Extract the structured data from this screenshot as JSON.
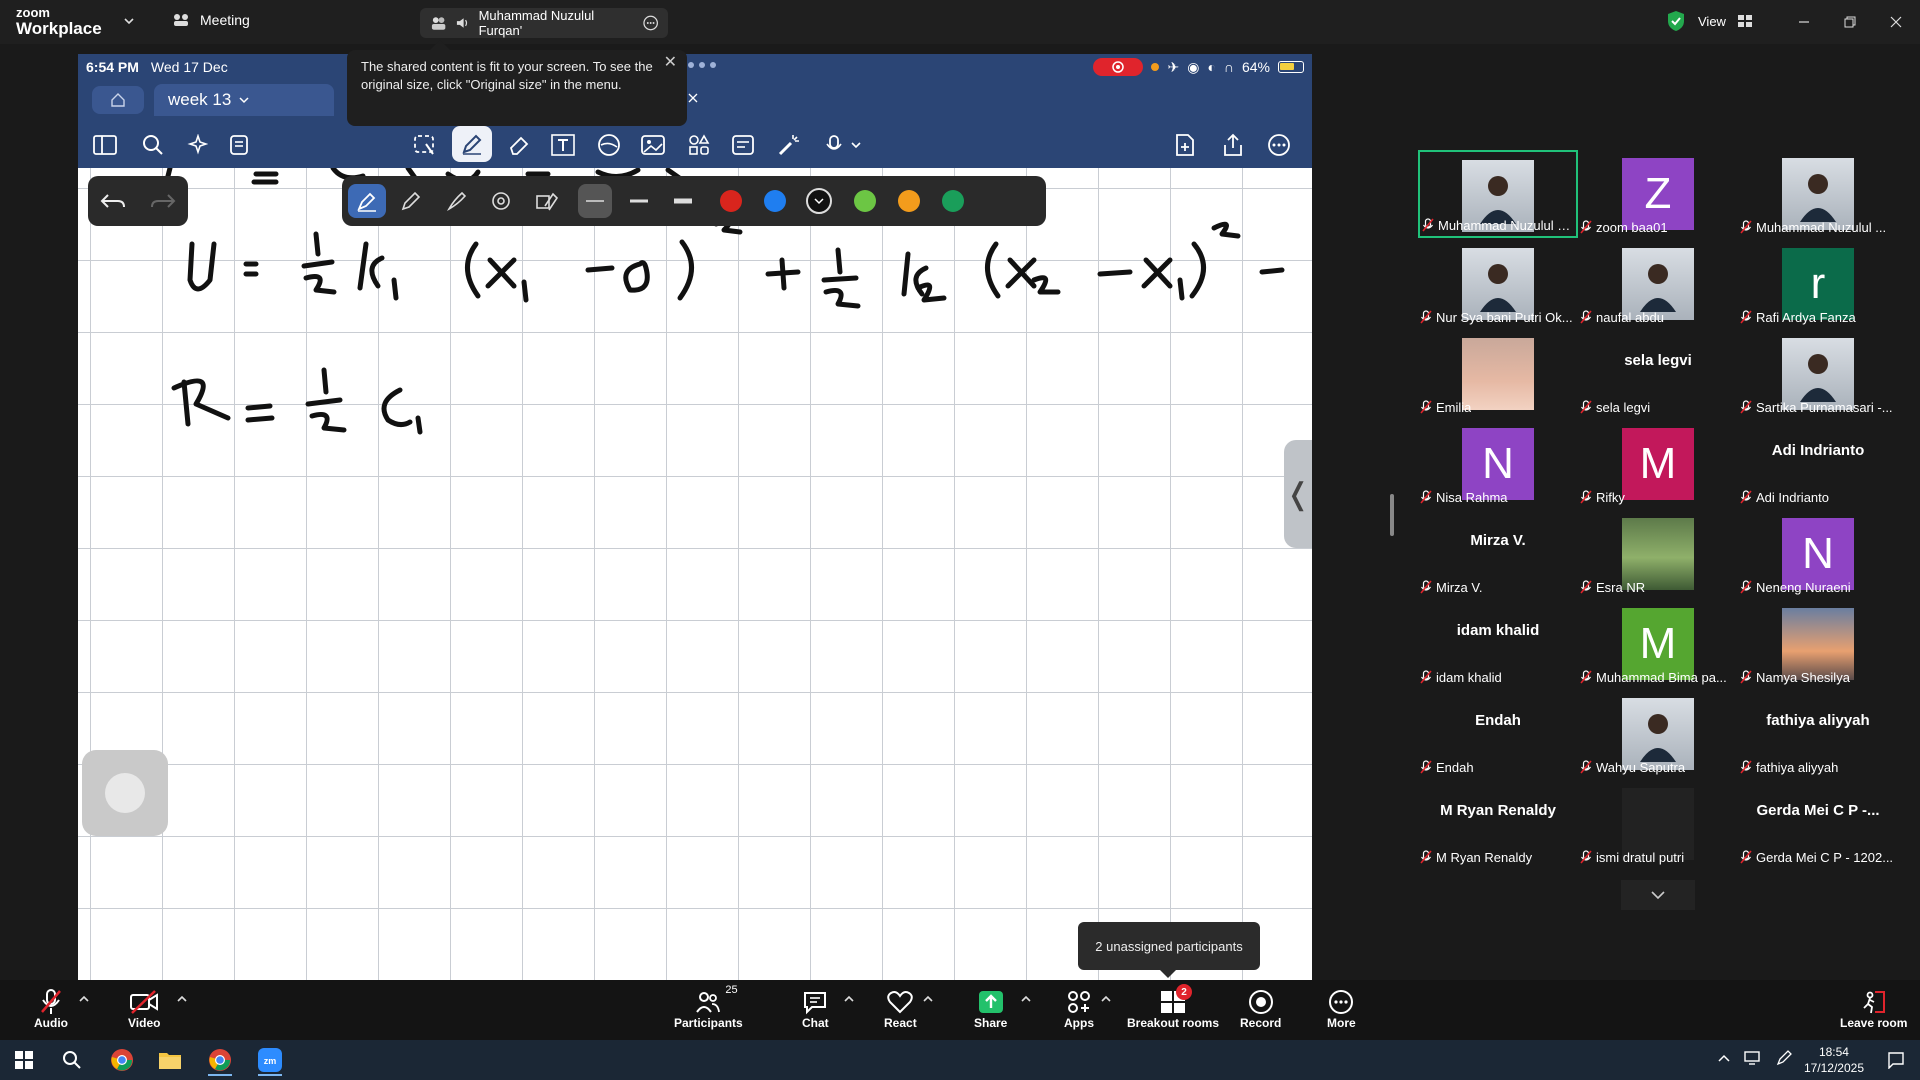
{
  "titlebar": {
    "logo_small": "zoom",
    "logo_big": "Workplace",
    "meeting_label": "Meeting",
    "sharer_name": "Muhammad Nuzulul Furqan'",
    "view_label": "View"
  },
  "ipad": {
    "time": "6:54 PM",
    "date": "Wed 17 Dec",
    "battery": "64%",
    "tab_title": "week 13"
  },
  "notice": {
    "text": "The shared content is fit to your screen. To see the original size, click \"Original size\" in the menu."
  },
  "pen_colors": [
    "#1a1a1a",
    "#d9251d",
    "#1f7ef0",
    "#111111",
    "#6cc644",
    "#f39c1c",
    "#1a9e5a"
  ],
  "gallery": {
    "tiles": [
      {
        "name": "Muhammad Nuzulul Fur...",
        "kind": "video",
        "highlight": true
      },
      {
        "name": "zoom baa01",
        "kind": "letter",
        "letter": "Z",
        "color": "#8e44c4"
      },
      {
        "name": "Muhammad Nuzulul ...",
        "kind": "video"
      },
      {
        "name": "Nur Sya bani Putri Ok...",
        "kind": "video"
      },
      {
        "name": "naufal abdu",
        "kind": "video"
      },
      {
        "name": "Rafi Ardya Fanza",
        "kind": "letter",
        "letter": "r",
        "color": "#0b6b4a"
      },
      {
        "name": "Emilia",
        "kind": "photo"
      },
      {
        "name": "sela legvi",
        "kind": "text",
        "display": "sela legvi"
      },
      {
        "name": "Sartika Purnamasari -...",
        "kind": "video"
      },
      {
        "name": "Nisa Rahma",
        "kind": "letter",
        "letter": "N",
        "color": "#8e44c4"
      },
      {
        "name": "Rifky",
        "kind": "letter",
        "letter": "M",
        "color": "#c2185b"
      },
      {
        "name": "Adi Indrianto",
        "kind": "text",
        "display": "Adi Indrianto"
      },
      {
        "name": "Mirza V.",
        "kind": "text",
        "display": "Mirza V."
      },
      {
        "name": "Esra NR",
        "kind": "photo"
      },
      {
        "name": "Neneng Nuraeni",
        "kind": "letter",
        "letter": "N",
        "color": "#8e44c4"
      },
      {
        "name": "idam khalid",
        "kind": "text",
        "display": "idam khalid"
      },
      {
        "name": "Muhammad Bima pa...",
        "kind": "letter",
        "letter": "M",
        "color": "#55a630"
      },
      {
        "name": "Namya Shesilya",
        "kind": "photo"
      },
      {
        "name": "Endah",
        "kind": "text",
        "display": "Endah"
      },
      {
        "name": "Wahyu Saputra",
        "kind": "video"
      },
      {
        "name": "fathiya aliyyah",
        "kind": "text",
        "display": "fathiya aliyyah"
      },
      {
        "name": "M Ryan Renaldy",
        "kind": "text",
        "display": "M Ryan Renaldy"
      },
      {
        "name": "ismi dratul putri",
        "kind": "blank"
      },
      {
        "name": "Gerda Mei C P - 1202...",
        "kind": "text",
        "display": "Gerda Mei C P -..."
      }
    ]
  },
  "breakout_tooltip": "2 unassigned participants",
  "controls": {
    "audio": "Audio",
    "video": "Video",
    "participants": "Participants",
    "participants_count": "25",
    "chat": "Chat",
    "react": "React",
    "share": "Share",
    "apps": "Apps",
    "breakout": "Breakout rooms",
    "breakout_badge": "2",
    "record": "Record",
    "more": "More",
    "leave": "Leave room"
  },
  "taskbar": {
    "time": "18:54",
    "date": "17/12/2025"
  }
}
